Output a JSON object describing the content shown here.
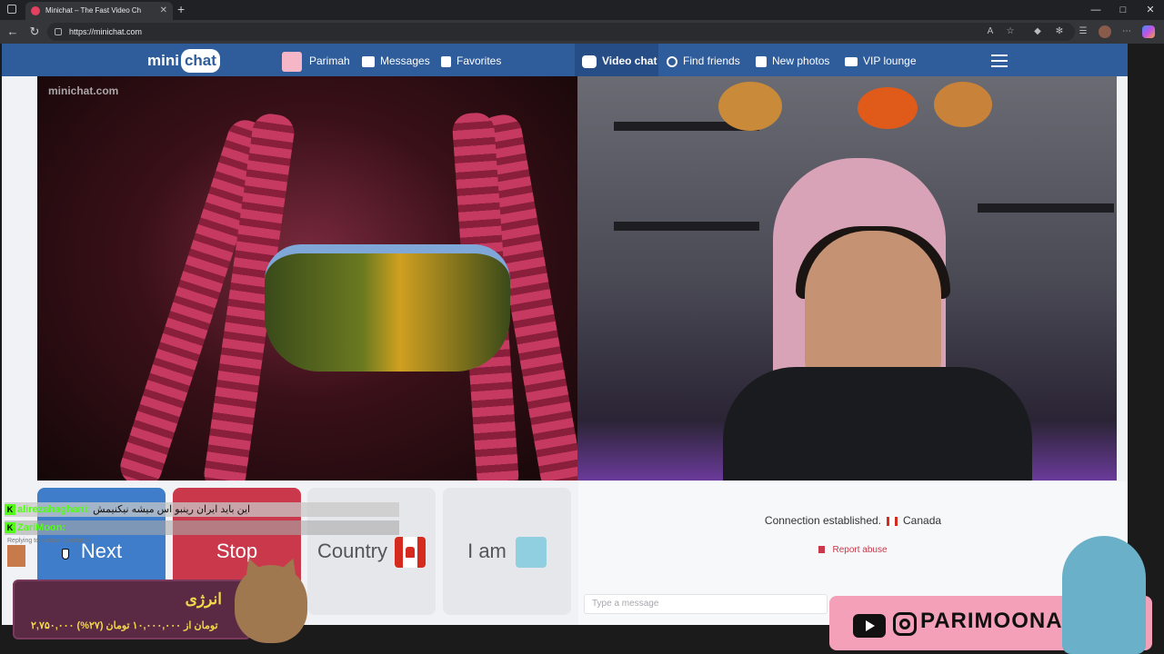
{
  "browser": {
    "tab_title": "Minichat – The Fast Video Ch",
    "url": "https://minichat.com"
  },
  "site": {
    "logo_mini": "mini",
    "logo_chat": "chat",
    "nav": {
      "user": "Parimah",
      "messages": "Messages",
      "favorites": "Favorites",
      "video_chat": "Video chat",
      "find_friends": "Find friends",
      "new_photos": "New photos",
      "vip_lounge": "VIP lounge"
    },
    "watermark": "minichat.com",
    "buttons": {
      "next": "Next",
      "stop": "Stop",
      "country": "Country",
      "i_am": "I am"
    },
    "status": {
      "text": "Connection established.",
      "country": "Canada"
    },
    "report": "Report abuse",
    "message_placeholder": "Type a message"
  },
  "overlay": {
    "chat": [
      {
        "user": "alirezahaghani:",
        "text": "این باید ایران رینبو اس میشه نیکنیمش"
      },
      {
        "user": "ZariMoon:",
        "text": ""
      }
    ],
    "reply_note": "Replying to siaasw: pacealipe",
    "energy_title": "انرژی",
    "energy_sub": "۲,۷۵۰,۰۰۰ تومان از ۱۰,۰۰۰,۰۰۰ تومان (۲۷%)",
    "social_handle": "PARIMOONAM"
  },
  "colors": {
    "nav_bg": "#2f5c9a",
    "next": "#3f7cc9",
    "stop": "#c9394b",
    "kick_green": "#53fc18"
  }
}
